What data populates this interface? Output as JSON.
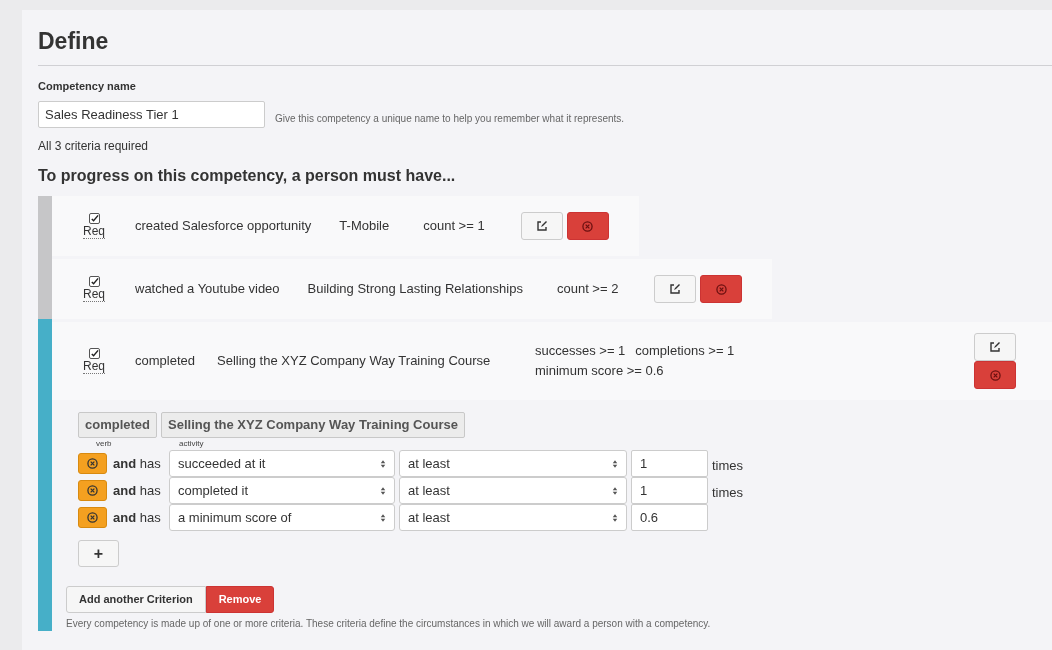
{
  "title": "Define",
  "name_field": {
    "label": "Competency name",
    "value": "Sales Readiness Tier 1",
    "help": "Give this competency a unique name to help you remember what it represents."
  },
  "requirement_summary": "All 3 criteria required",
  "criteria_heading": "To progress on this competency, a person must have...",
  "criteria": [
    {
      "required": true,
      "req_label": "Req",
      "verb": "created Salesforce opportunity",
      "activity": "T-Mobile",
      "conditions": [
        "count >= 1"
      ],
      "selected": false
    },
    {
      "required": true,
      "req_label": "Req",
      "verb": "watched a Youtube video",
      "activity": "Building Strong Lasting Relationships",
      "conditions": [
        "count >= 2"
      ],
      "selected": false
    },
    {
      "required": true,
      "req_label": "Req",
      "verb": "completed",
      "activity": "Selling the XYZ Company Way Training Course",
      "conditions": [
        "successes >= 1",
        "completions >= 1",
        "minimum score >= 0.6"
      ],
      "selected": true
    }
  ],
  "editor": {
    "verb": {
      "value": "completed",
      "caption": "verb"
    },
    "activity": {
      "value": "Selling the XYZ Company Way Training Course",
      "caption": "activity"
    },
    "rules": [
      {
        "joiner": "**and** has",
        "measure": "succeeded at it",
        "comparison": "at least",
        "value": "1",
        "unit": "times"
      },
      {
        "joiner": "**and** has",
        "measure": "completed it",
        "comparison": "at least",
        "value": "1",
        "unit": "times"
      },
      {
        "joiner": "**and** has",
        "measure": "a minimum score of",
        "comparison": "at least",
        "value": "0.6"
      }
    ],
    "add_rule": "+",
    "buttons": [
      {
        "kind": "default",
        "label": "Add another Criterion"
      },
      {
        "kind": "danger",
        "label": "Remove"
      }
    ],
    "note": "Every competency is made up of one or more criteria. These criteria define the circumstances in which we will award a person with a competency."
  }
}
